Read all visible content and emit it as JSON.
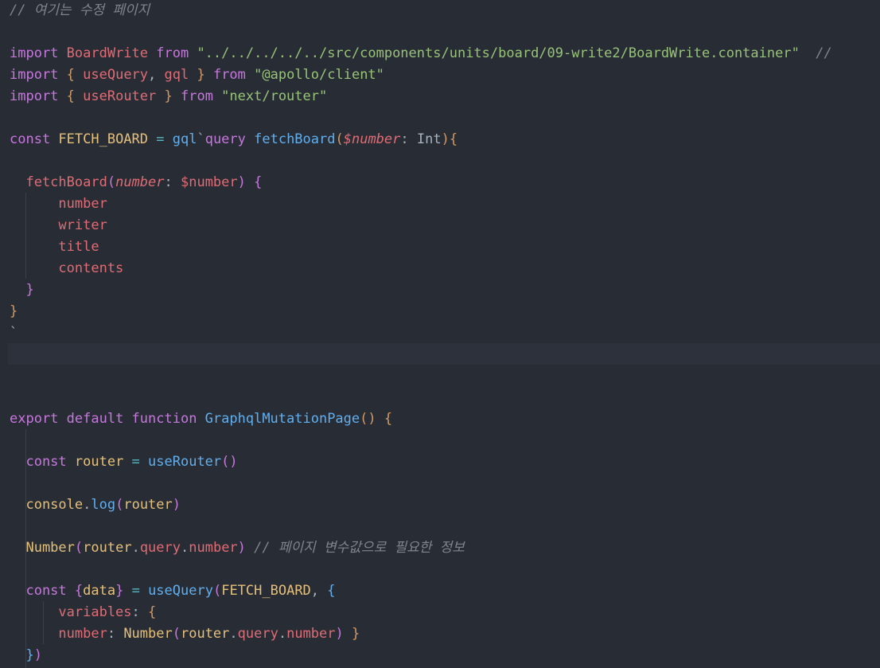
{
  "editor": {
    "colors": {
      "background": "#282c34",
      "keyword": "#c678dd",
      "string": "#98c379",
      "function": "#61afef",
      "variable": "#e06c75",
      "constant": "#e5c07b",
      "comment": "#7f848e"
    },
    "lines": [
      {
        "tokens": [
          {
            "t": "// 여기는 수정 페이지",
            "c": "c"
          }
        ]
      },
      {
        "tokens": []
      },
      {
        "tokens": [
          {
            "t": "import ",
            "c": "k"
          },
          {
            "t": "BoardWrite ",
            "c": "v"
          },
          {
            "t": "from ",
            "c": "k"
          },
          {
            "t": "\"../../../../../src/components/units/board/09-write2/BoardWrite.container\"",
            "c": "s"
          },
          {
            "t": "  //",
            "c": "c"
          }
        ]
      },
      {
        "tokens": [
          {
            "t": "import ",
            "c": "k"
          },
          {
            "t": "{ ",
            "c": "b1"
          },
          {
            "t": "useQuery",
            "c": "v"
          },
          {
            "t": ", ",
            "c": "d"
          },
          {
            "t": "gql",
            "c": "v"
          },
          {
            "t": " } ",
            "c": "b1"
          },
          {
            "t": "from ",
            "c": "k"
          },
          {
            "t": "\"@apollo/client\"",
            "c": "s"
          }
        ]
      },
      {
        "tokens": [
          {
            "t": "import ",
            "c": "k"
          },
          {
            "t": "{ ",
            "c": "b1"
          },
          {
            "t": "useRouter",
            "c": "v"
          },
          {
            "t": " } ",
            "c": "b1"
          },
          {
            "t": "from ",
            "c": "k"
          },
          {
            "t": "\"next/router\"",
            "c": "s"
          }
        ]
      },
      {
        "tokens": []
      },
      {
        "tokens": [
          {
            "t": "const ",
            "c": "k"
          },
          {
            "t": "FETCH_BOARD",
            "c": "y"
          },
          {
            "t": " = ",
            "c": "gr"
          },
          {
            "t": "gql",
            "c": "f"
          },
          {
            "t": "`",
            "c": "d"
          },
          {
            "t": "query ",
            "c": "k"
          },
          {
            "t": "fetchBoard",
            "c": "f"
          },
          {
            "t": "(",
            "c": "b1"
          },
          {
            "t": "$number",
            "c": "v i"
          },
          {
            "t": ": Int",
            "c": "d"
          },
          {
            "t": "){",
            "c": "b1"
          }
        ]
      },
      {
        "tokens": []
      },
      {
        "tokens": [
          {
            "t": "  fetchBoard",
            "c": "v"
          },
          {
            "t": "(",
            "c": "b2"
          },
          {
            "t": "number",
            "c": "v i"
          },
          {
            "t": ": ",
            "c": "d"
          },
          {
            "t": "$number",
            "c": "v"
          },
          {
            "t": ") ",
            "c": "b2"
          },
          {
            "t": "{",
            "c": "b2"
          }
        ]
      },
      {
        "tokens": [
          {
            "t": "      number",
            "c": "v"
          }
        ]
      },
      {
        "tokens": [
          {
            "t": "      writer",
            "c": "v"
          }
        ]
      },
      {
        "tokens": [
          {
            "t": "      title",
            "c": "v"
          }
        ]
      },
      {
        "tokens": [
          {
            "t": "      contents",
            "c": "v"
          }
        ]
      },
      {
        "tokens": [
          {
            "t": "  }",
            "c": "b2"
          }
        ]
      },
      {
        "tokens": [
          {
            "t": "}",
            "c": "b1"
          }
        ]
      },
      {
        "tokens": [
          {
            "t": "`",
            "c": "d"
          }
        ]
      },
      {
        "tokens": []
      },
      {
        "tokens": []
      },
      {
        "tokens": []
      },
      {
        "tokens": [
          {
            "t": "export ",
            "c": "k"
          },
          {
            "t": "default ",
            "c": "k"
          },
          {
            "t": "function ",
            "c": "k"
          },
          {
            "t": "GraphqlMutationPage",
            "c": "f"
          },
          {
            "t": "() ",
            "c": "b1"
          },
          {
            "t": "{",
            "c": "b1"
          }
        ]
      },
      {
        "tokens": []
      },
      {
        "tokens": [
          {
            "t": "  const ",
            "c": "k"
          },
          {
            "t": "router",
            "c": "y"
          },
          {
            "t": " = ",
            "c": "gr"
          },
          {
            "t": "useRouter",
            "c": "f"
          },
          {
            "t": "()",
            "c": "b2"
          }
        ]
      },
      {
        "tokens": []
      },
      {
        "tokens": [
          {
            "t": "  console",
            "c": "y"
          },
          {
            "t": ".",
            "c": "d"
          },
          {
            "t": "log",
            "c": "f"
          },
          {
            "t": "(",
            "c": "b2"
          },
          {
            "t": "router",
            "c": "y"
          },
          {
            "t": ")",
            "c": "b2"
          }
        ]
      },
      {
        "tokens": []
      },
      {
        "tokens": [
          {
            "t": "  Number",
            "c": "y"
          },
          {
            "t": "(",
            "c": "b2"
          },
          {
            "t": "router",
            "c": "y"
          },
          {
            "t": ".",
            "c": "d"
          },
          {
            "t": "query",
            "c": "v"
          },
          {
            "t": ".",
            "c": "d"
          },
          {
            "t": "number",
            "c": "v"
          },
          {
            "t": ") ",
            "c": "b2"
          },
          {
            "t": "// 페이지 변수값으로 필요한 정보",
            "c": "c"
          }
        ]
      },
      {
        "tokens": []
      },
      {
        "tokens": [
          {
            "t": "  const ",
            "c": "k"
          },
          {
            "t": "{",
            "c": "b2"
          },
          {
            "t": "data",
            "c": "y"
          },
          {
            "t": "}",
            "c": "b2"
          },
          {
            "t": " = ",
            "c": "gr"
          },
          {
            "t": "useQuery",
            "c": "f"
          },
          {
            "t": "(",
            "c": "b2"
          },
          {
            "t": "FETCH_BOARD",
            "c": "y"
          },
          {
            "t": ", ",
            "c": "d"
          },
          {
            "t": "{",
            "c": "b3"
          }
        ]
      },
      {
        "tokens": [
          {
            "t": "      variables",
            "c": "v"
          },
          {
            "t": ": ",
            "c": "d"
          },
          {
            "t": "{",
            "c": "b1"
          }
        ]
      },
      {
        "tokens": [
          {
            "t": "      number",
            "c": "v"
          },
          {
            "t": ": ",
            "c": "d"
          },
          {
            "t": "Number",
            "c": "y"
          },
          {
            "t": "(",
            "c": "b2"
          },
          {
            "t": "router",
            "c": "y"
          },
          {
            "t": ".",
            "c": "d"
          },
          {
            "t": "query",
            "c": "v"
          },
          {
            "t": ".",
            "c": "d"
          },
          {
            "t": "number",
            "c": "v"
          },
          {
            "t": ") ",
            "c": "b2"
          },
          {
            "t": "}",
            "c": "b1"
          }
        ]
      },
      {
        "tokens": [
          {
            "t": "  }",
            "c": "b3"
          },
          {
            "t": ")",
            "c": "b2"
          }
        ]
      }
    ]
  }
}
